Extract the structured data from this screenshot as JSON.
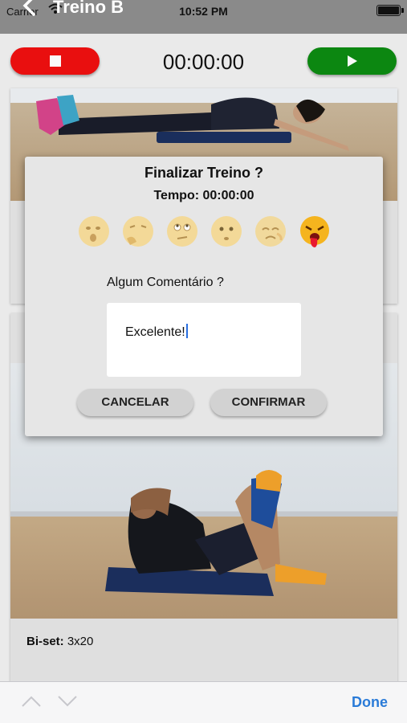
{
  "status": {
    "carrier": "Carrier",
    "time": "10:52 PM"
  },
  "nav": {
    "title": "Treino B"
  },
  "timer": {
    "display": "00:00:00"
  },
  "exercise": {
    "caption_bold": "Bi-set:",
    "caption_value": "3x20"
  },
  "dialog": {
    "title": "Finalizar Treino ?",
    "time_label": "Tempo: 00:00:00",
    "comment_label": "Algum Comentário ?",
    "comment_value": "Excelente!",
    "cancel_label": "CANCELAR",
    "confirm_label": "CONFIRMAR",
    "ratings": [
      {
        "icon": "sleepy-emoji-icon",
        "selected": false
      },
      {
        "icon": "thinking-emoji-icon",
        "selected": false
      },
      {
        "icon": "eyeroll-emoji-icon",
        "selected": false
      },
      {
        "icon": "worried-emoji-icon",
        "selected": false
      },
      {
        "icon": "sad-emoji-icon",
        "selected": false
      },
      {
        "icon": "exhausted-emoji-icon",
        "selected": true
      }
    ]
  },
  "keyboard_accessory": {
    "done_label": "Done"
  },
  "colors": {
    "stop": "#ee1010",
    "play": "#0d8a12",
    "done": "#2a7bd8",
    "dialog_bg": "#e6e6e6"
  }
}
